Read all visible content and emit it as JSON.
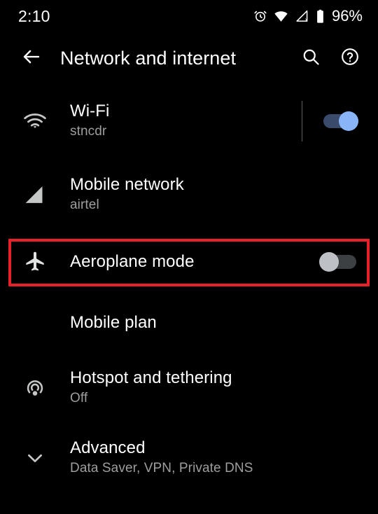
{
  "status_bar": {
    "time": "2:10",
    "battery_percent": "96%",
    "icons": [
      "alarm-clock-icon",
      "wifi-icon",
      "cellular-signal-off-icon",
      "battery-icon"
    ]
  },
  "toolbar": {
    "back_label": "back-arrow",
    "title": "Network and internet",
    "search_label": "search",
    "help_label": "help"
  },
  "settings": {
    "rows": [
      {
        "icon": "wifi-icon",
        "title": "Wi-Fi",
        "subtitle": "stncdr",
        "toggle": "on",
        "divider": true
      },
      {
        "icon": "cellular-signal-icon",
        "title": "Mobile network",
        "subtitle": "airtel",
        "toggle": "none",
        "divider": false
      },
      {
        "icon": "airplane-icon",
        "title": "Aeroplane mode",
        "subtitle": "",
        "toggle": "off",
        "divider": false
      },
      {
        "icon": "none",
        "title": "Mobile plan",
        "subtitle": "",
        "toggle": "none",
        "divider": false
      },
      {
        "icon": "hotspot-icon",
        "title": "Hotspot and tethering",
        "subtitle": "Off",
        "toggle": "none",
        "divider": false
      },
      {
        "icon": "chevron-down-icon",
        "title": "Advanced",
        "subtitle": "Data Saver, VPN, Private DNS",
        "toggle": "none",
        "divider": false
      }
    ]
  },
  "annotation": {
    "target": "Aeroplane mode",
    "color": "#e8202a"
  },
  "colors": {
    "background": "#000000",
    "text_primary": "#ffffff",
    "text_secondary": "#9e9e9e",
    "toggle_on_thumb": "#8ab4f8",
    "toggle_on_track": "#3a4a6b",
    "toggle_off_thumb": "#bdc1c6",
    "toggle_off_track": "#3c4043",
    "annotation": "#e8202a"
  }
}
